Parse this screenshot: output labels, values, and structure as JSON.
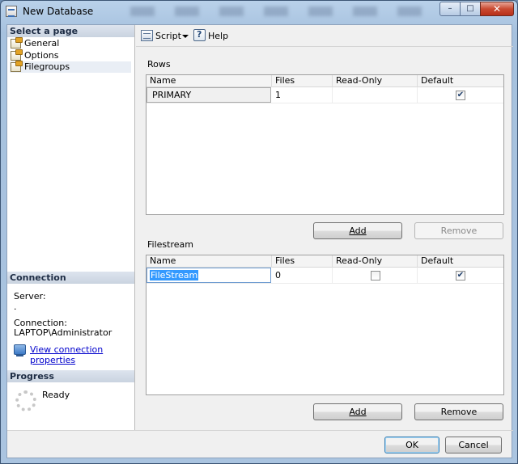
{
  "window": {
    "title": "New Database",
    "min_glyph": "–",
    "max_glyph": "□",
    "close_glyph": "✕"
  },
  "left": {
    "select_page_header": "Select a page",
    "pages": [
      {
        "label": "General"
      },
      {
        "label": "Options"
      },
      {
        "label": "Filegroups"
      }
    ],
    "connection_header": "Connection",
    "server_label": "Server:",
    "server_value": ".",
    "connection_label": "Connection:",
    "connection_value": "LAPTOP\\Administrator",
    "view_connection_link": "View connection properties",
    "progress_header": "Progress",
    "progress_status": "Ready"
  },
  "toolbar": {
    "script_label": "Script",
    "help_label": "Help"
  },
  "rows_section": {
    "label": "Rows",
    "columns": [
      "Name",
      "Files",
      "Read-Only",
      "Default"
    ],
    "rows": [
      {
        "name": "PRIMARY",
        "files": "1",
        "read_only": false,
        "default": true
      }
    ],
    "add_label": "Add",
    "remove_label": "Remove"
  },
  "filestream_section": {
    "label": "Filestream",
    "columns": [
      "Name",
      "Files",
      "Read-Only",
      "Default"
    ],
    "rows": [
      {
        "name": "FileStream",
        "files": "0",
        "read_only": false,
        "default": true
      }
    ],
    "add_label": "Add",
    "remove_label": "Remove"
  },
  "footer": {
    "ok_label": "OK",
    "cancel_label": "Cancel"
  },
  "check_glyph": "✔"
}
